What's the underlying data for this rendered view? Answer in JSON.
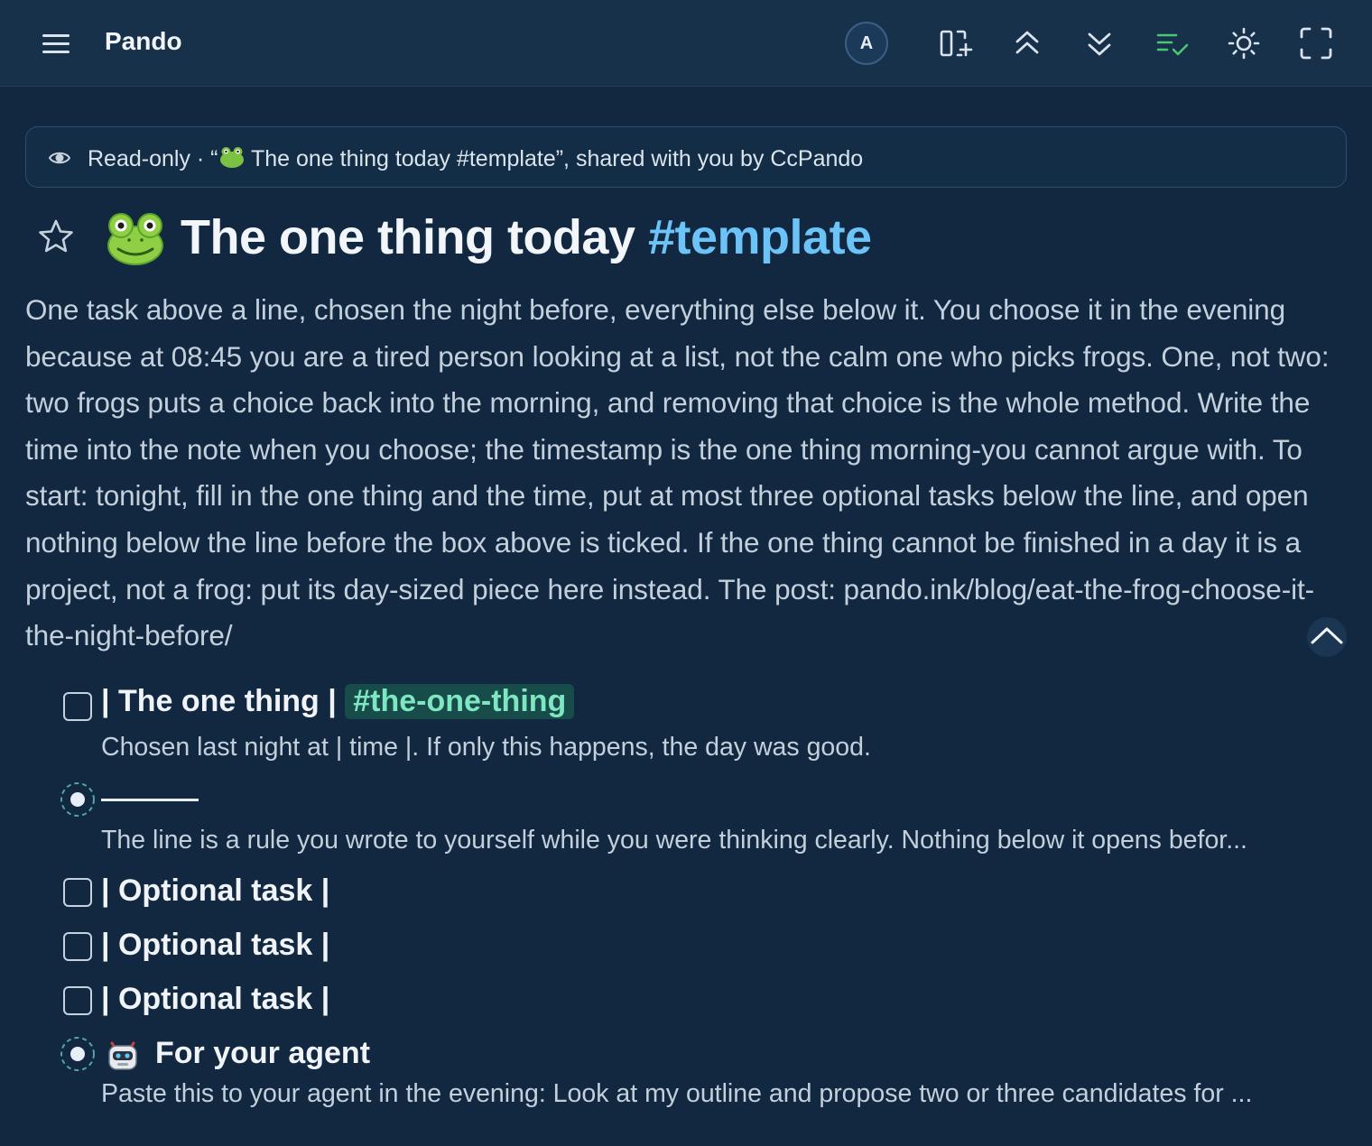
{
  "app": {
    "title": "Pando",
    "avatar_initial": "A"
  },
  "toolbar": {
    "buttons": [
      {
        "icon": "add-panel-icon"
      },
      {
        "icon": "collapse-all-icon"
      },
      {
        "icon": "expand-all-icon"
      },
      {
        "icon": "list-check-icon",
        "color": "#48c774"
      },
      {
        "icon": "sun-icon"
      },
      {
        "icon": "fullscreen-icon"
      }
    ]
  },
  "banner": {
    "prefix": "Read-only · “",
    "suffix": " The one thing today #template”, shared with you by CcPando"
  },
  "document": {
    "title": "The one thing today ",
    "title_tag": "#template",
    "description": "One task above a line, chosen the night before, everything else below it. You choose it in the evening because at 08:45 you are a tired person looking at a list, not the calm one who picks frogs. One, not two: two frogs puts a choice back into the morning, and removing that choice is the whole method. Write the time into the note when you choose; the timestamp is the one thing morning-you cannot argue with. To start: tonight, fill in the one thing and the time, put at most three optional tasks below the line, and open nothing below the line before the box above is ticked. If the one thing cannot be finished in a day it is a project, not a frog: put its day-sized piece here instead. The post: pando.ink/blog/eat-the-frog-choose-it-the-night-before/"
  },
  "outline": {
    "one_thing": {
      "label": "| The one thing | ",
      "tag": "#the-one-thing",
      "note": "Chosen last night at | time |. If only this happens, the day was good."
    },
    "line_note": "The line is a rule you wrote to yourself while you were thinking clearly. Nothing below it opens befor...",
    "optional_tasks": [
      "| Optional task |",
      "| Optional task |",
      "| Optional task |"
    ],
    "agent": {
      "label": "For your agent",
      "note": "Paste this to your agent in the evening: Look at my outline and propose two or three candidates for ..."
    }
  },
  "colors": {
    "background": "#112840",
    "topbar": "#17314b",
    "title_tag": "#6cc3f7",
    "hashtag_bg": "#174c4a",
    "hashtag_fg": "#7ee6c0",
    "bullet_ring": "#4fa7a0"
  }
}
